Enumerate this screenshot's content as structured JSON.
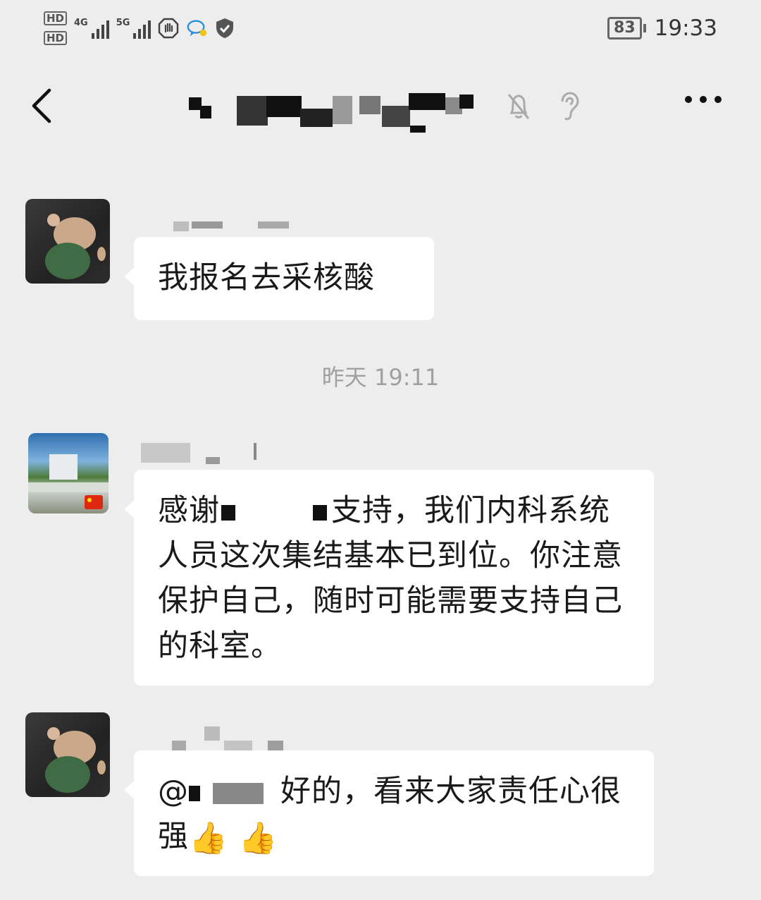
{
  "status_bar": {
    "hd1": "HD",
    "hd2": "HD",
    "net1": "4G",
    "net2": "5G",
    "battery": "83",
    "time": "19:33"
  },
  "header": {
    "back_icon": "chevron-left-icon",
    "mute_icon": "bell-off-icon",
    "earpiece_icon": "ear-icon",
    "more_icon": "more-dots-icon"
  },
  "messages": [
    {
      "text": "我报名去采核酸"
    },
    {
      "timestamp": "昨天 19:11"
    },
    {
      "text_before": "感谢",
      "text_after": "支持，我们内科系统人员这次集结基本已到位。你注意保护自己，随时可能需要支持自己的科室。"
    },
    {
      "mention": "@",
      "text": "好的，看来大家责任心很强"
    }
  ],
  "colors": {
    "background": "#ededed",
    "bubble": "#ffffff",
    "timestamp": "#a0a0a0"
  }
}
